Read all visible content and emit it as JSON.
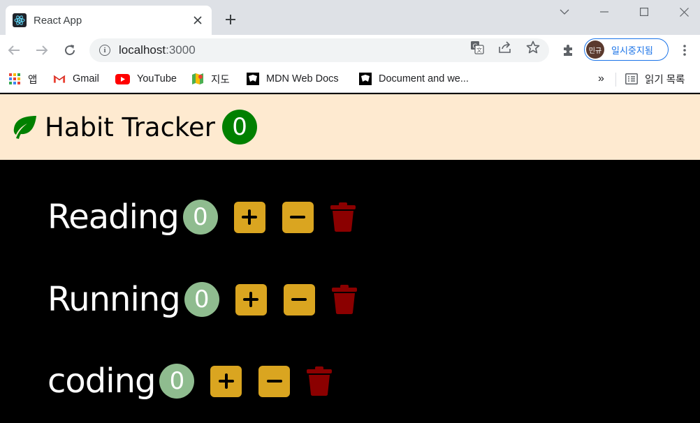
{
  "browser": {
    "tab_title": "React App",
    "url_host": "localhost",
    "url_port": ":3000",
    "profile_label": "일시중지됨",
    "profile_avatar_text": "민규",
    "bookmarks": [
      {
        "label": "앱",
        "icon": "apps-grid-icon"
      },
      {
        "label": "Gmail",
        "icon": "gmail-icon"
      },
      {
        "label": "YouTube",
        "icon": "youtube-icon"
      },
      {
        "label": "지도",
        "icon": "maps-icon"
      },
      {
        "label": "MDN Web Docs",
        "icon": "mdn-icon"
      },
      {
        "label": "Document and we...",
        "icon": "mdn-icon"
      }
    ],
    "overflow_label": "»",
    "reading_list_label": "읽기 목록"
  },
  "app": {
    "title": "Habit Tracker",
    "total_count": "0",
    "accent_color": "#008000",
    "header_bg": "#feead0"
  },
  "habits": [
    {
      "name": "Reading",
      "count": "0"
    },
    {
      "name": "Running",
      "count": "0"
    },
    {
      "name": "coding",
      "count": "0"
    }
  ],
  "colors": {
    "button_bg": "#daa520",
    "count_bg": "#8fbc8f",
    "trash": "#8b0000"
  }
}
